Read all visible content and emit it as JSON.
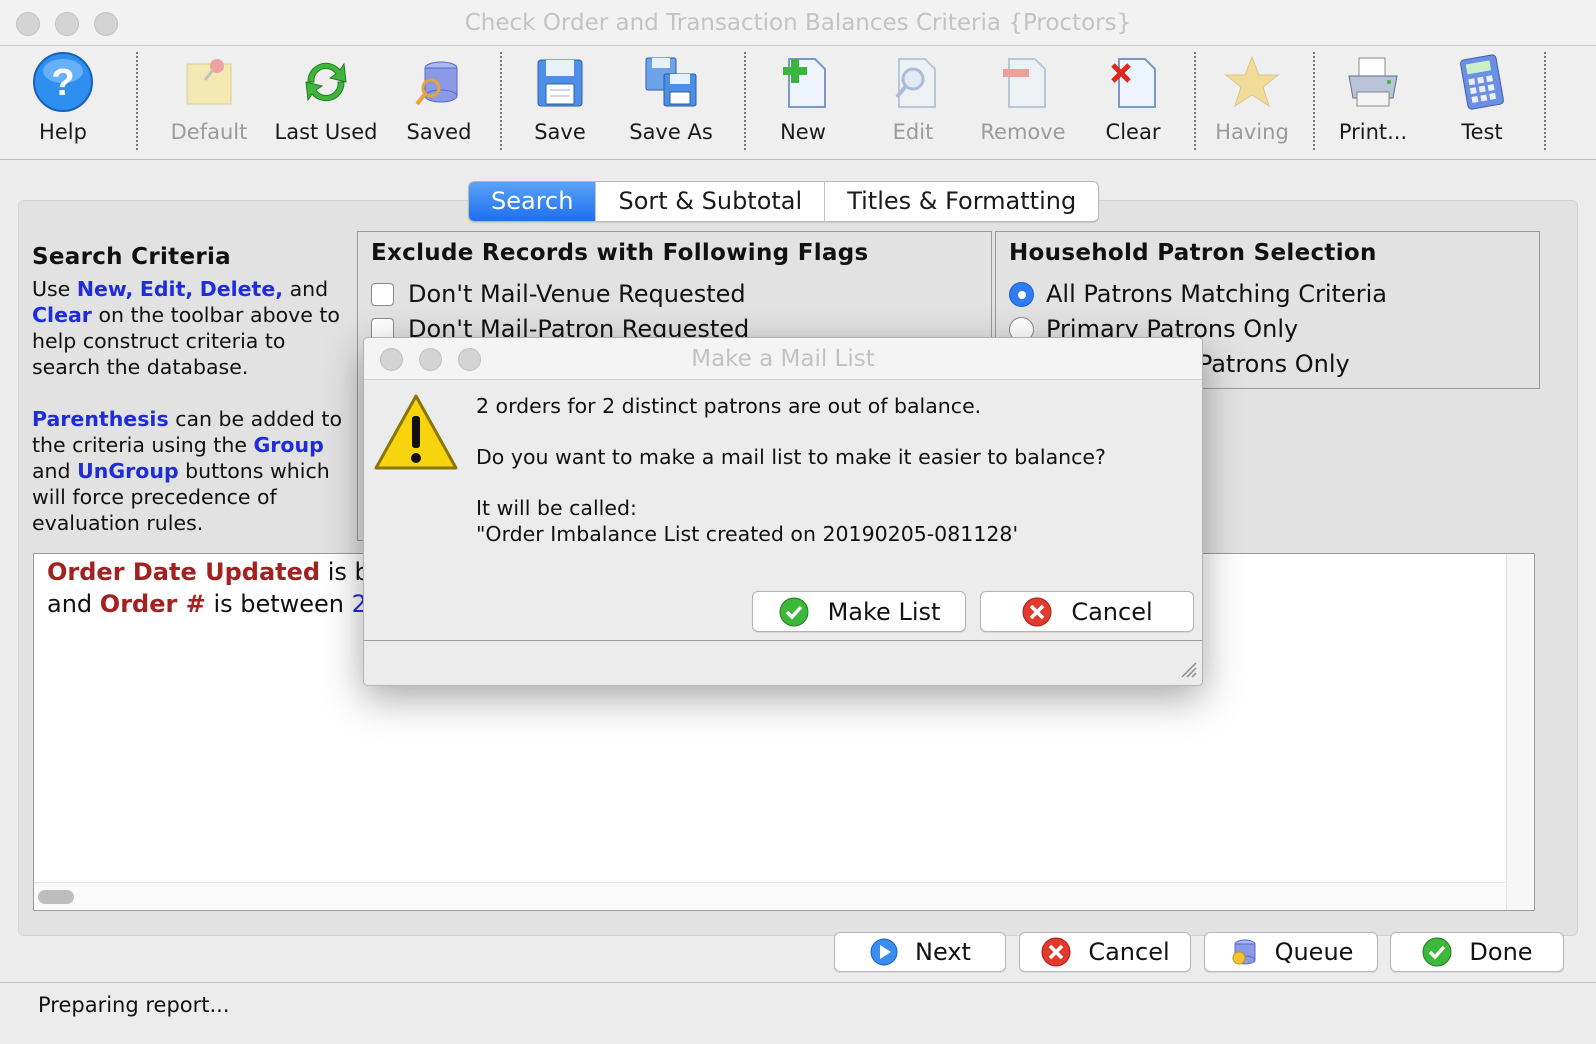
{
  "window": {
    "title": "Check Order and Transaction Balances Criteria {Proctors}"
  },
  "toolbar": {
    "help": "Help",
    "default": "Default",
    "last_used": "Last Used",
    "saved": "Saved",
    "save": "Save",
    "save_as": "Save As",
    "new": "New",
    "edit": "Edit",
    "remove": "Remove",
    "clear": "Clear",
    "having": "Having",
    "print": "Print...",
    "test": "Test"
  },
  "tabs": [
    "Search",
    "Sort & Subtotal",
    "Titles & Formatting"
  ],
  "search_criteria": {
    "heading": "Search Criteria",
    "p1": {
      "use": "Use",
      "new": "New,",
      "edit": "Edit,",
      "delete": "Delete,",
      "and": "and",
      "clear": "Clear",
      "rest": "on the toolbar above to help construct criteria to search the database."
    },
    "p2": {
      "parenthesis": "Parenthesis",
      "part1": "can be added to the criteria using the",
      "group": "Group",
      "and": "and",
      "ungroup": "UnGroup",
      "part2": "buttons which will force precedence of evaluation rules."
    }
  },
  "exclude_flags": {
    "heading": "Exclude Records with Following Flags",
    "items": [
      "Don't Mail-Venue Requested",
      "Don't Mail-Patron Requested"
    ]
  },
  "household": {
    "heading": "Household Patron Selection",
    "options": [
      "All Patrons Matching Criteria",
      "Primary Patrons Only",
      "y Patrons Only"
    ],
    "selected": 0
  },
  "criteria_lines": [
    {
      "field": "Order Date Updated",
      "text": "is b",
      "value": ""
    },
    {
      "prefix": "and",
      "field": "Order #",
      "text": "is between",
      "value": "2"
    }
  ],
  "dialog": {
    "title": "Make a Mail List",
    "line1": "2 orders for 2 distinct patrons are out of balance.",
    "line2": "Do you want to make a mail list to make it easier to balance?",
    "line3": "It will be called:",
    "line4": "\"Order Imbalance List created on 20190205-081128'",
    "make_list": "Make List",
    "cancel": "Cancel"
  },
  "bottom_buttons": {
    "next": "Next",
    "cancel": "Cancel",
    "queue": "Queue",
    "done": "Done"
  },
  "status": "Preparing report...",
  "colors": {
    "keyword": "#1f2cd9",
    "field": "#a52020",
    "tab_active": "#1f6ef0"
  }
}
